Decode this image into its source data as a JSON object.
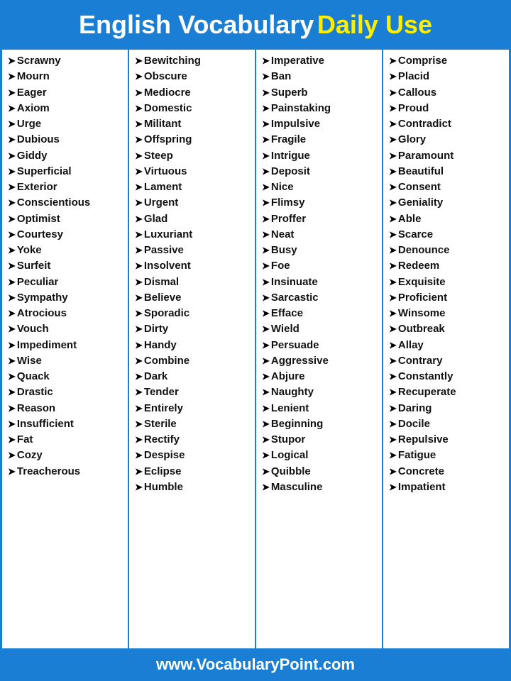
{
  "header": {
    "white_text": "English Vocabulary",
    "yellow_text": "Daily Use"
  },
  "columns": [
    {
      "words": [
        "Scrawny",
        "Mourn",
        "Eager",
        "Axiom",
        "Urge",
        "Dubious",
        "Giddy",
        "Superficial",
        "Exterior",
        "Conscientious",
        "Optimist",
        "Courtesy",
        "Yoke",
        "Surfeit",
        "Peculiar",
        "Sympathy",
        "Atrocious",
        "Vouch",
        "Impediment",
        "Wise",
        "Quack",
        "Drastic",
        "Reason",
        "Insufficient",
        "Fat",
        "Cozy",
        "Treacherous"
      ]
    },
    {
      "words": [
        "Bewitching",
        "Obscure",
        "Mediocre",
        "Domestic",
        "Militant",
        "Offspring",
        "Steep",
        "Virtuous",
        "Lament",
        "Urgent",
        "Glad",
        "Luxuriant",
        "Passive",
        "Insolvent",
        "Dismal",
        "Believe",
        "Sporadic",
        "Dirty",
        "Handy",
        "Combine",
        "Dark",
        "Tender",
        "Entirely",
        "Sterile",
        "Rectify",
        "Despise",
        "Eclipse",
        "Humble"
      ]
    },
    {
      "words": [
        "Imperative",
        "Ban",
        "Superb",
        "Painstaking",
        "Impulsive",
        "Fragile",
        "Intrigue",
        "Deposit",
        "Nice",
        "Flimsy",
        "Proffer",
        "Neat",
        "Busy",
        "Foe",
        "Insinuate",
        "Sarcastic",
        "Efface",
        "Wield",
        "Persuade",
        "Aggressive",
        "Abjure",
        "Naughty",
        "Lenient",
        "Beginning",
        "Stupor",
        "Logical",
        "Quibble",
        "Masculine"
      ]
    },
    {
      "words": [
        "Comprise",
        "Placid",
        "Callous",
        "Proud",
        "Contradict",
        "Glory",
        "Paramount",
        "Beautiful",
        "Consent",
        "Geniality",
        "Able",
        "Scarce",
        "Denounce",
        "Redeem",
        "Exquisite",
        "Proficient",
        "Winsome",
        "Outbreak",
        "Allay",
        "Contrary",
        "Constantly",
        "Recuperate",
        "Daring",
        "Docile",
        "Repulsive",
        "Fatigue",
        "Concrete",
        "Impatient"
      ]
    }
  ],
  "footer": {
    "url": "www.VocabularyPoint.com"
  }
}
